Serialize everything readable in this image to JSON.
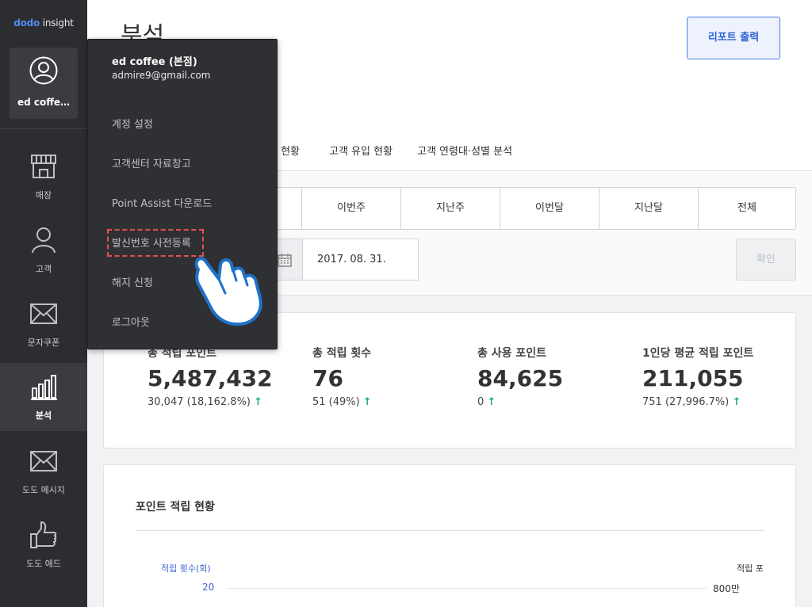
{
  "brand": {
    "part1": "dodo",
    "part2": " insight"
  },
  "account": {
    "name_short": "ed coffe…"
  },
  "sidebar": {
    "items": [
      {
        "label": "매장",
        "icon": "store-icon"
      },
      {
        "label": "고객",
        "icon": "person-icon"
      },
      {
        "label": "문자쿠폰",
        "icon": "envelope-icon"
      },
      {
        "label": "분석",
        "icon": "bar-chart-icon",
        "active": true
      },
      {
        "label": "도도 메시지",
        "icon": "envelope-icon"
      },
      {
        "label": "도도 애드",
        "icon": "thumbs-up-icon"
      }
    ]
  },
  "header": {
    "title": "분석",
    "report_button": "리포트 출력"
  },
  "tabs": [
    "용 현황",
    "고객 유입 현황",
    "고객 연령대·성별 분석"
  ],
  "filter": {
    "periods": [
      "이번주",
      "지난주",
      "이번달",
      "지난달",
      "전체"
    ],
    "date_value": "2017. 08. 31.",
    "confirm_label": "확인"
  },
  "stats": [
    {
      "label": "총 적립 포인트",
      "value": "5,487,432",
      "delta": "30,047 (18,162.8%)",
      "trend": "up"
    },
    {
      "label": "총 적립 횟수",
      "value": "76",
      "delta": "51 (49%)",
      "trend": "up"
    },
    {
      "label": "총 사용 포인트",
      "value": "84,625",
      "delta": "0",
      "trend": "up"
    },
    {
      "label": "1인당 평균 적립 포인트",
      "value": "211,055",
      "delta": "751 (27,996.7%)",
      "trend": "up"
    }
  ],
  "chart_section": {
    "title": "포인트 적립 현황",
    "left_axis_label": "적립 횟수(회)",
    "right_axis_label": "적립 포",
    "left_tick": "20",
    "right_tick": "800만"
  },
  "menu": {
    "name": "ed coffee (본점)",
    "email": "admire9@gmail.com",
    "items": [
      "계정 설정",
      "고객센터 자료창고",
      "Point Assist 다운로드",
      "발신번호 사전등록",
      "해지 신청",
      "로그아웃"
    ]
  },
  "colors": {
    "sidebar_bg": "#2c2d30",
    "accent_blue": "#2f62d6",
    "up_green": "#1aae7a",
    "highlight_red": "#e25151"
  }
}
